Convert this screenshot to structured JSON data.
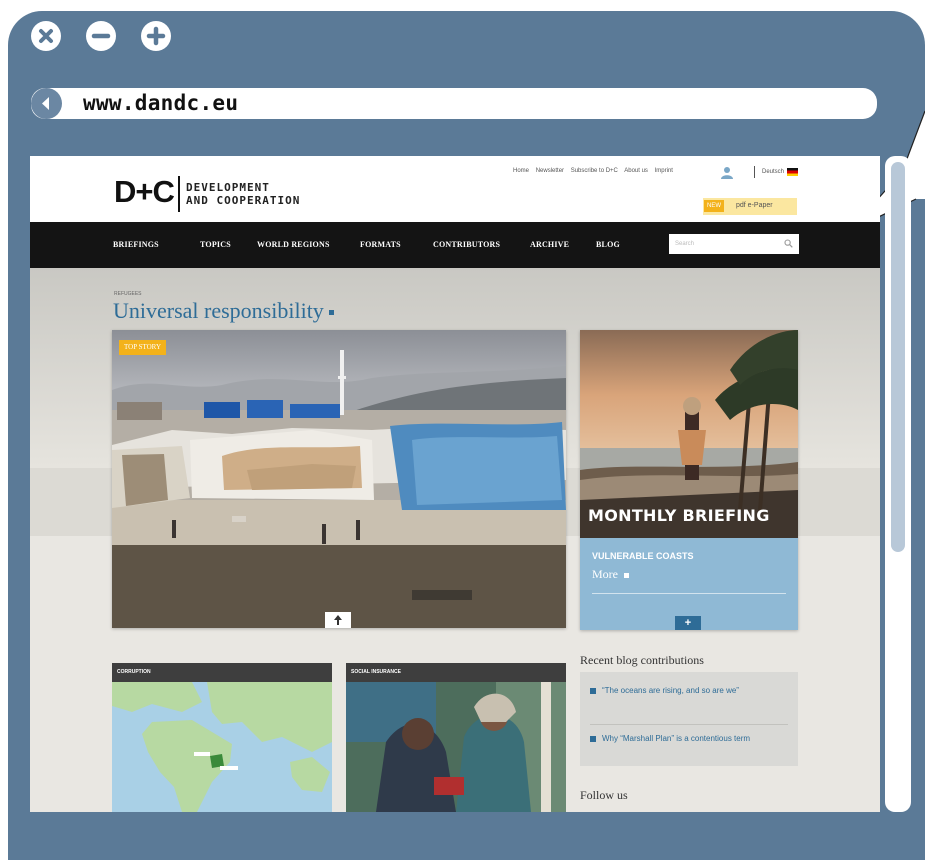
{
  "browser": {
    "url": "www.dandc.eu",
    "controls": [
      "close-icon",
      "minimize-icon",
      "maximize-icon"
    ]
  },
  "site": {
    "logo": "D+C",
    "logo_subtitle_line1": "DEVELOPMENT",
    "logo_subtitle_line2": "AND COOPERATION",
    "top_links": [
      "Home",
      "Newsletter",
      "Subscribe to D+C",
      "About us",
      "Imprint"
    ],
    "language": "Deutsch",
    "epaper": {
      "badge": "NEW",
      "label": "pdf e-Paper"
    },
    "nav": [
      "BRIEFINGS",
      "TOPICS",
      "WORLD REGIONS",
      "FORMATS",
      "CONTRIBUTORS",
      "ARCHIVE",
      "BLOG"
    ],
    "search_placeholder": "Search"
  },
  "main": {
    "kicker": "REFUGEES",
    "headline": "Universal responsibility",
    "top_story_tag": "TOP STORY",
    "briefing": {
      "title": "MONTHLY BRIEFING",
      "subtitle": "VULNERABLE COASTS",
      "more": "More",
      "plus": "+"
    },
    "cards": [
      {
        "category": "CORRUPTION"
      },
      {
        "category": "SOCIAL INSURANCE"
      }
    ],
    "blog": {
      "title": "Recent blog contributions",
      "items": [
        "“The oceans are rising, and so are we”",
        "Why “Marshall Plan” is a contentious term"
      ]
    },
    "follow": "Follow us"
  },
  "colors": {
    "frame": "#5b7a97",
    "nav_bg": "#141414",
    "accent": "#2e6c97",
    "tag": "#f3b21b",
    "briefing_panel": "#8fb9d5"
  }
}
